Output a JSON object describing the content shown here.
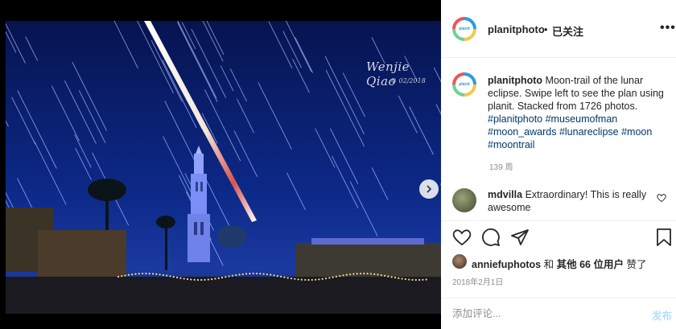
{
  "photo": {
    "watermark": "Wenjie Qiao",
    "watermark_date": "© 02/2018",
    "carousel_dots": 2,
    "active_dot": 0
  },
  "header": {
    "username": "planitphoto",
    "separator": "•",
    "follow_status": "已关注",
    "more_icon": "more-horizontal-icon"
  },
  "caption": {
    "username": "planitphoto",
    "text": "Moon-trail of the lunar eclipse. Swipe left to see the plan using planit. Stacked from 1726 photos.",
    "hashtags": [
      "#planitphoto",
      "#museumofman",
      "#moon_awards",
      "#lunareclipse",
      "#moon",
      "#moontrail"
    ],
    "age": "139 周"
  },
  "comment": {
    "username": "mdvilla",
    "text": "Extraordinary! This is really awesome"
  },
  "actions": {
    "like_icon": "heart-icon",
    "comment_icon": "comment-icon",
    "share_icon": "share-icon",
    "save_icon": "bookmark-icon"
  },
  "likes": {
    "username": "anniefuphotos",
    "connector": "和",
    "others": "其他 66 位用户",
    "suffix": "赞了"
  },
  "date": "2018年2月1日",
  "add_comment": {
    "placeholder": "添加评论...",
    "post_label": "发布"
  },
  "colors": {
    "sky": "#0a1a5c",
    "hashtag": "#00376b",
    "post_disabled": "#b2dffc",
    "muted": "#8e8e8e"
  }
}
